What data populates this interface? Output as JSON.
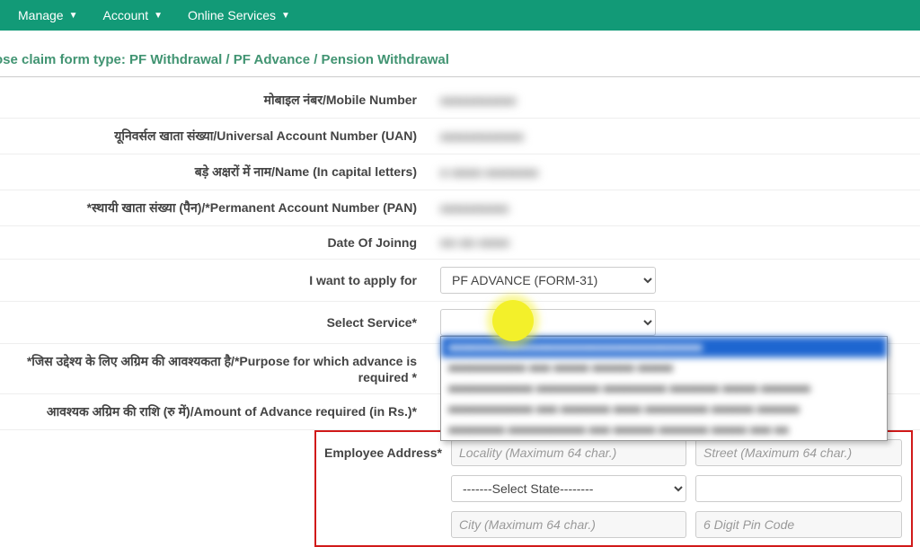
{
  "nav": {
    "manage": "Manage",
    "account": "Account",
    "services": "Online Services"
  },
  "title": "ose claim form type: PF Withdrawal / PF Advance / Pension Withdrawal",
  "labels": {
    "mobile": "मोबाइल नंबर/Mobile Number",
    "uan": "यूनिवर्सल खाता संख्या/Universal Account Number (UAN)",
    "name": "बड़े अक्षरों में नाम/Name (In capital letters)",
    "pan": "*स्थायी खाता संख्या (पैन)/*Permanent Account Number (PAN)",
    "doj": "Date Of Joinng",
    "apply": "I want to apply for",
    "service": "Select Service*",
    "purpose": "*जिस उद्देश्य के लिए अग्रिम की आवश्यकता है/*Purpose for which advance is required *",
    "amount": "आवश्यक अग्रिम की राशि (रु में)/Amount of Advance required (in Rs.)*",
    "address": "Employee Address*"
  },
  "values": {
    "mobile_mask": "■■■■■■■■■■",
    "uan_mask": "■■■■■■■■■■■",
    "name_mask": "■ ■■■■ ■■■■■■■",
    "pan_mask": "■■■■■■■■■",
    "doj_mask": "■■-■■-■■■■",
    "apply_option": "PF ADVANCE (FORM-31)"
  },
  "dropdown_options": [
    "■■■■■■■■■■■■■■■■■■■■■■■■■■■■■■■■■■■■",
    "■■■■■■■■■■■ ■■■ ■■■■■ ■■■■■■ ■■■■■",
    "■■■■■■■■■■■■ ■■■■■■■■■ ■■■■■■■■■ ■■■■■■■ ■■■■■ ■■■■■■■",
    "■■■■■■■■■■■■ ■■■ ■■■■■■■ ■■■■ ■■■■■■■■■ ■■■■■■ ■■■■■■",
    "■■■■■■■■ ■■■■■■■■■■■ ■■■ ■■■■■■ ■■■■■■■ ■■■■■ ■■■ ■■"
  ],
  "placeholders": {
    "locality": "Locality (Maximum 64 char.)",
    "street": "Street (Maximum 64 char.)",
    "state": "-------Select State--------",
    "city": "City (Maximum 64 char.)",
    "pin": "6 Digit Pin Code"
  }
}
